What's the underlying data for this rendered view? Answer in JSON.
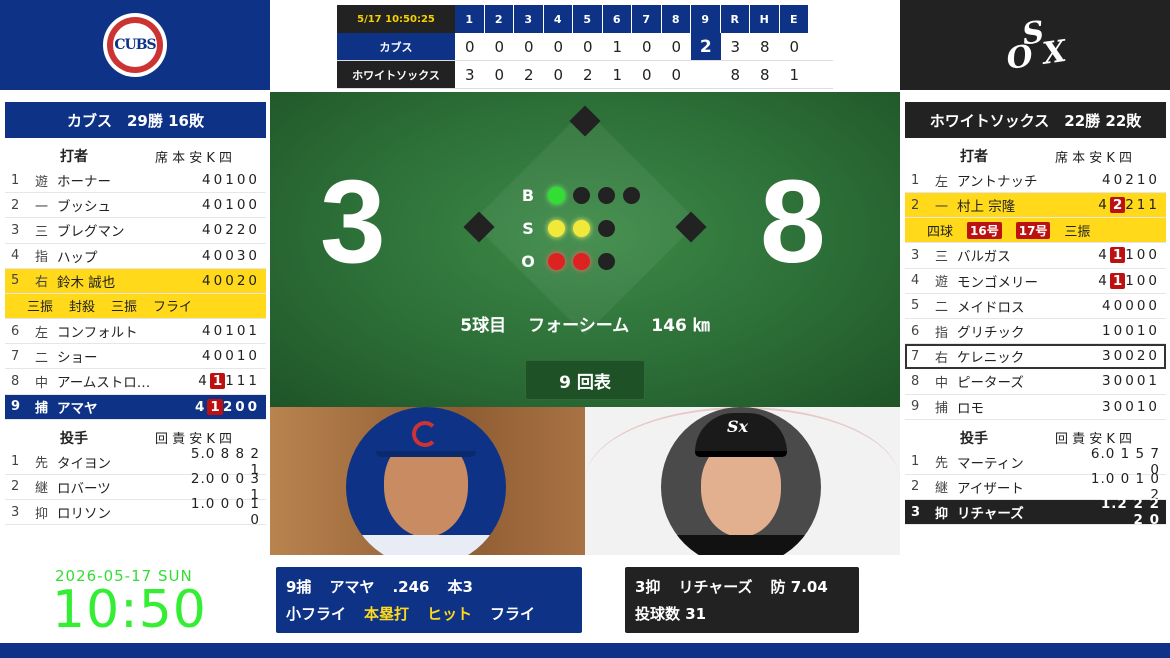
{
  "colors": {
    "cubs_blue": "#0e3386",
    "sox_black": "#222222",
    "highlight": "#ffd91a",
    "clock_green": "#33dd33"
  },
  "linescore": {
    "timestamp": "5/17 10:50:25",
    "headers": [
      "1",
      "2",
      "3",
      "4",
      "5",
      "6",
      "7",
      "8",
      "9",
      "R",
      "H",
      "E"
    ],
    "teams": [
      {
        "name": "カブス",
        "cells": [
          "0",
          "0",
          "0",
          "0",
          "0",
          "1",
          "0",
          "0",
          "2",
          "3",
          "8",
          "0"
        ]
      },
      {
        "name": "ホワイトソックス",
        "cells": [
          "3",
          "0",
          "2",
          "0",
          "2",
          "1",
          "0",
          "0",
          "",
          "8",
          "8",
          "1"
        ]
      }
    ]
  },
  "left": {
    "header": "カブス　29勝 16敗",
    "batters_label": "打者",
    "batters_cols": "席 本 安 K 四",
    "batters": [
      {
        "ord": "1",
        "pos": "遊",
        "name": "ホーナー",
        "stats": "40100"
      },
      {
        "ord": "2",
        "pos": "一",
        "name": "ブッシュ",
        "stats": "40100"
      },
      {
        "ord": "3",
        "pos": "三",
        "name": "ブレグマン",
        "stats": "40220"
      },
      {
        "ord": "4",
        "pos": "指",
        "name": "ハップ",
        "stats": "40030"
      },
      {
        "ord": "5",
        "pos": "右",
        "name": "鈴木 誠也",
        "stats": "40020"
      },
      {
        "ord": "6",
        "pos": "左",
        "name": "コンフォルト",
        "stats": "40101"
      },
      {
        "ord": "7",
        "pos": "二",
        "name": "ショー",
        "stats": "40010"
      },
      {
        "ord": "8",
        "pos": "中",
        "name": "アームストロ…",
        "s1": "4",
        "badge": "1",
        "s2": "111"
      },
      {
        "ord": "9",
        "pos": "捕",
        "name": "アマヤ",
        "s1": "4",
        "badge": "1",
        "s2": "200"
      }
    ],
    "suzuki_results": [
      "三振",
      "封殺",
      "三振",
      "フライ"
    ],
    "pitchers_label": "投手",
    "pitchers_cols": "回 責 安 K 四",
    "pitchers": [
      {
        "ord": "1",
        "pos": "先",
        "name": "タイヨン",
        "stats": "5.0 8 8 2 1"
      },
      {
        "ord": "2",
        "pos": "継",
        "name": "ロバーツ",
        "stats": "2.0 0 0 3 1"
      },
      {
        "ord": "3",
        "pos": "抑",
        "name": "ロリソン",
        "stats": "1.0 0 0 1 0"
      }
    ]
  },
  "right": {
    "header": "ホワイトソックス　22勝 22敗",
    "batters_label": "打者",
    "batters_cols": "席 本 安 K 四",
    "batters": [
      {
        "ord": "1",
        "pos": "左",
        "name": "アントナッチ",
        "stats": "40210"
      },
      {
        "ord": "2",
        "pos": "一",
        "name": "村上 宗隆",
        "s1": "4",
        "badge": "2",
        "s2": "211"
      },
      {
        "ord": "3",
        "pos": "三",
        "name": "バルガス",
        "s1": "4",
        "badge": "1",
        "s2": "100"
      },
      {
        "ord": "4",
        "pos": "遊",
        "name": "モンゴメリー",
        "s1": "4",
        "badge": "1",
        "s2": "100"
      },
      {
        "ord": "5",
        "pos": "二",
        "name": "メイドロス",
        "stats": "40000"
      },
      {
        "ord": "6",
        "pos": "指",
        "name": "グリチック",
        "stats": "10010"
      },
      {
        "ord": "7",
        "pos": "右",
        "name": "ケレニック",
        "stats": "30020"
      },
      {
        "ord": "8",
        "pos": "中",
        "name": "ピーターズ",
        "stats": "30001"
      },
      {
        "ord": "9",
        "pos": "捕",
        "name": "ロモ",
        "stats": "30010"
      }
    ],
    "murakami_results": {
      "r1": "四球",
      "hr1": "16号",
      "hr2": "17号",
      "r4": "三振"
    },
    "pitchers_label": "投手",
    "pitchers_cols": "回 責 安 K 四",
    "pitchers": [
      {
        "ord": "1",
        "pos": "先",
        "name": "マーティン",
        "stats": "6.0 1 5 7 0"
      },
      {
        "ord": "2",
        "pos": "継",
        "name": "アイザート",
        "stats": "1.0 0 1 0 2"
      },
      {
        "ord": "3",
        "pos": "抑",
        "name": "リチャーズ",
        "stats": "1.2 2 2 2 0"
      }
    ]
  },
  "field": {
    "away_score": "3",
    "home_score": "8",
    "bso_labels": [
      "B",
      "S",
      "O"
    ],
    "balls": 1,
    "strikes": 2,
    "outs": 2,
    "pitch_count_text": "5球目",
    "pitch_type": "フォーシーム",
    "pitch_speed": "146 ㎞",
    "inning": "9 回表"
  },
  "batter_info": {
    "order_pos": "9捕",
    "name": "アマヤ",
    "avg": ".246",
    "hr": "本3",
    "results": [
      "小フライ",
      "本塁打",
      "ヒット",
      "フライ"
    ]
  },
  "pitcher_info": {
    "order_pos": "3抑",
    "name": "リチャーズ",
    "era": "防 7.04",
    "pitch_count": "投球数 31"
  },
  "clock": {
    "date": "2026-05-17 SUN",
    "time": "10:50"
  }
}
